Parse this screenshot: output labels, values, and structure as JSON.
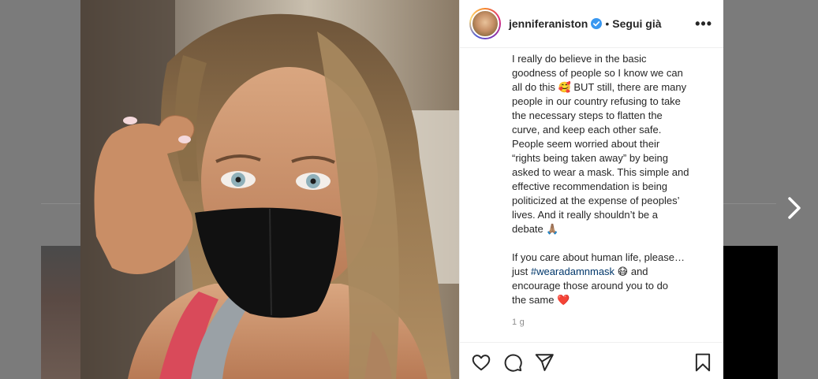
{
  "post": {
    "username": "jenniferaniston",
    "follow_separator": "•",
    "follow_label": "Segui già",
    "more_label": "•••",
    "caption_lines": [
      "I really do believe in the basic",
      "goodness of people so I know we can",
      "all do this 🥰 BUT still, there are many",
      "people in our country refusing to take",
      "the necessary steps to flatten the",
      "curve, and keep each other safe.",
      "People seem worried about their",
      "“rights being taken away” by being",
      "asked to wear a mask. This simple and",
      "effective recommendation is being",
      "politicized at the expense of peoples’",
      "lives. And it really shouldn’t be a",
      "debate 🙏🏽"
    ],
    "caption_line14": "If you care about human life, please…",
    "caption_line15_prefix": "just ",
    "hashtag": "#wearadamnmask",
    "caption_line15_suffix": " 😷 and",
    "caption_line16": "encourage those around you to do",
    "caption_line17": "the same ❤️",
    "time": "1 g"
  },
  "icons": {
    "verified": "verified-badge-icon",
    "like": "heart-icon",
    "comment": "comment-icon",
    "share": "paper-plane-icon",
    "save": "bookmark-icon",
    "next": "chevron-right-icon"
  },
  "colors": {
    "verified": "#3897f0",
    "hashtag": "#00376b",
    "text": "#262626",
    "muted": "#8e8e8e"
  }
}
